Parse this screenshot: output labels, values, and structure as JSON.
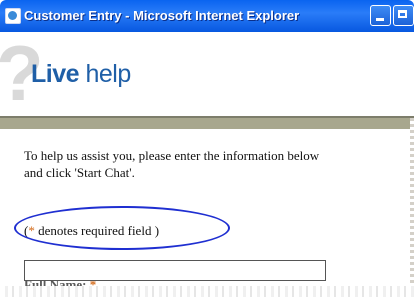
{
  "window": {
    "title": "Customer Entry - Microsoft Internet Explorer"
  },
  "header": {
    "brand_live": "Live",
    "brand_help": " help"
  },
  "form": {
    "instructions_line1": "To help us assist you, please enter the information below",
    "instructions_line2": "and click 'Start Chat'.",
    "required_open": "(",
    "required_star": "*",
    "required_text": " denotes required field )",
    "full_name_label": "Full Name: ",
    "full_name_star": "*",
    "full_name_value": ""
  },
  "colors": {
    "title_bar": "#0a64f0",
    "brand": "#1f5fa7",
    "header_bar": "#a8a78e",
    "required_star": "#d36a1a",
    "highlight_ring": "#1f2fd1"
  },
  "icons": [
    "browser-icon",
    "minimize-icon",
    "maximize-icon",
    "question-mark-icon"
  ]
}
